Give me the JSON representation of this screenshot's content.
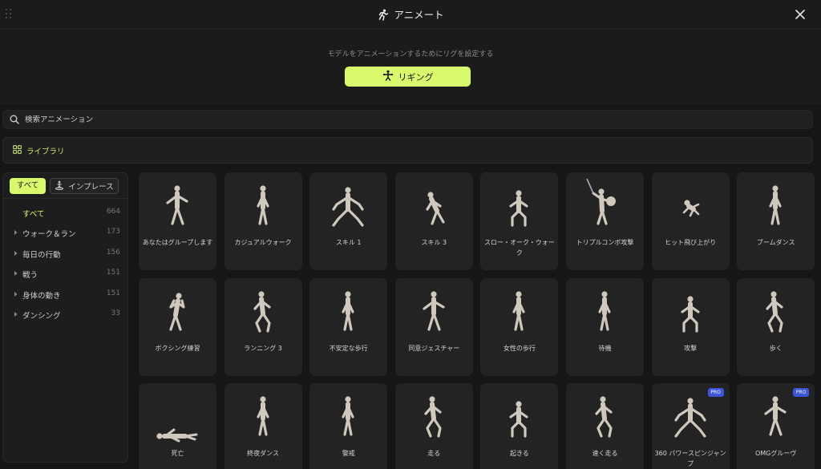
{
  "header": {
    "title": "アニメート"
  },
  "rigging": {
    "hint": "モデルをアニメーションするためにリグを設定する",
    "button_label": "リギング"
  },
  "search": {
    "placeholder": "検索アニメーション"
  },
  "library": {
    "label": "ライブラリ"
  },
  "filters": {
    "all": "すべて",
    "in_place": "インプレース"
  },
  "categories": [
    {
      "label": "すべて",
      "count": "664",
      "expandable": false,
      "active": true
    },
    {
      "label": "ウォーク＆ラン",
      "count": "173",
      "expandable": true
    },
    {
      "label": "毎日の行動",
      "count": "156",
      "expandable": true
    },
    {
      "label": "戦う",
      "count": "151",
      "expandable": true
    },
    {
      "label": "身体の動き",
      "count": "151",
      "expandable": true
    },
    {
      "label": "ダンシング",
      "count": "33",
      "expandable": true
    }
  ],
  "animations": [
    {
      "label": "あなたはグループします",
      "pose": "arms-out"
    },
    {
      "label": "カジュアルウォーク",
      "pose": "stand"
    },
    {
      "label": "スキル 1",
      "pose": "wide"
    },
    {
      "label": "スキル 3",
      "pose": "lean"
    },
    {
      "label": "スロー・オーク・ウォーク",
      "pose": "crouch"
    },
    {
      "label": "トリプルコンボ攻撃",
      "pose": "sword"
    },
    {
      "label": "ヒット飛び上がり",
      "pose": "fall"
    },
    {
      "label": "ブームダンス",
      "pose": "stand"
    },
    {
      "label": "ボクシング練習",
      "pose": "boxing"
    },
    {
      "label": "ランニング 3",
      "pose": "run"
    },
    {
      "label": "不安定な歩行",
      "pose": "stand"
    },
    {
      "label": "同意ジェスチャー",
      "pose": "arms-out"
    },
    {
      "label": "女性の歩行",
      "pose": "stand"
    },
    {
      "label": "待機",
      "pose": "stand"
    },
    {
      "label": "攻撃",
      "pose": "crouch"
    },
    {
      "label": "歩く",
      "pose": "run"
    },
    {
      "label": "死亡",
      "pose": "lying"
    },
    {
      "label": "終夜ダンス",
      "pose": "stand"
    },
    {
      "label": "警戒",
      "pose": "stand"
    },
    {
      "label": "走る",
      "pose": "run"
    },
    {
      "label": "起きる",
      "pose": "crouch"
    },
    {
      "label": "速く走る",
      "pose": "run"
    },
    {
      "label": "360 パワースピンジャンプ",
      "pose": "wide",
      "pro": true,
      "badge": "PRO"
    },
    {
      "label": "OMGグルーヴ",
      "pose": "arms-out",
      "pro": true,
      "badge": "PRO"
    }
  ],
  "icons": {
    "header": "running-figure-icon",
    "close": "close-icon",
    "rig": "rig-figure-icon",
    "search": "search-icon",
    "library": "grid-icon",
    "in_place": "figure-on-base-icon",
    "expand": "caret-right-icon"
  },
  "colors": {
    "accent": "#d7f96b",
    "pro_badge": "#3c55d8"
  }
}
